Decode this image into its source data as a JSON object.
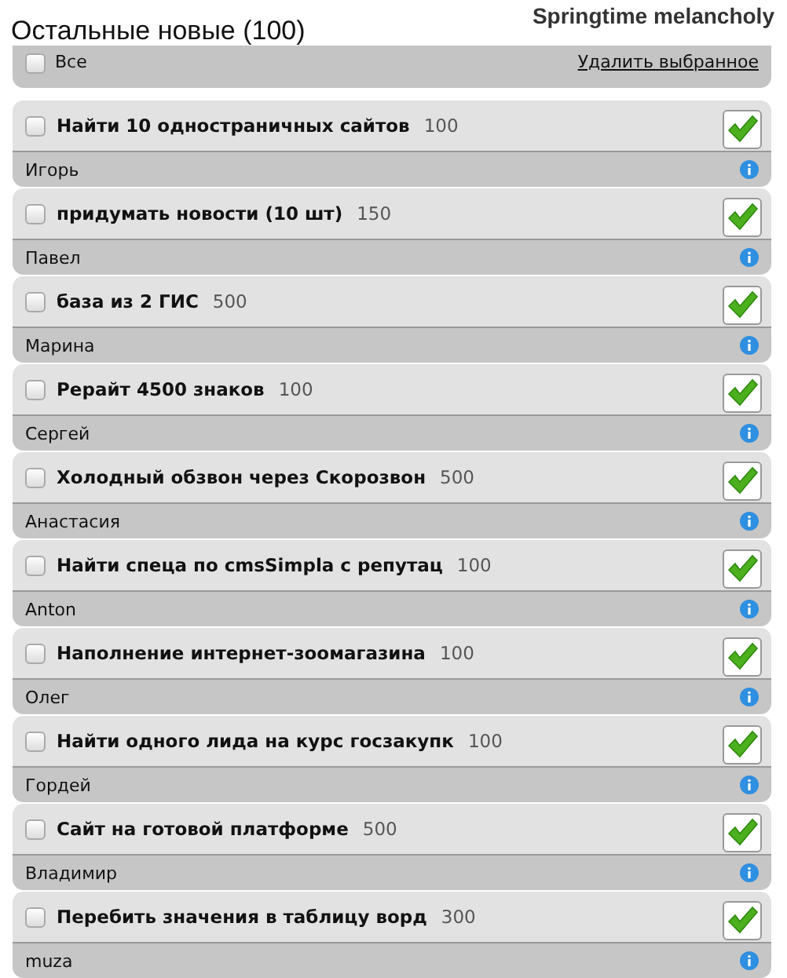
{
  "title": "Остальные новые (100)",
  "user": "Springtime melancholy",
  "select_all": {
    "label": "Все",
    "checked": false
  },
  "delete_link": "Удалить выбранное",
  "tasks": [
    {
      "title": "Найти 10 одностраничных сайтов",
      "price": "100",
      "author": "Игорь",
      "checked": false
    },
    {
      "title": "придумать новости (10 шт)",
      "price": "150",
      "author": "Павел",
      "checked": false
    },
    {
      "title": "база из 2 ГИС",
      "price": "500",
      "author": "Марина",
      "checked": false
    },
    {
      "title": "Рерайт 4500 знаков",
      "price": "100",
      "author": "Сергей",
      "checked": false
    },
    {
      "title": "Холодный обзвон через Скорозвон",
      "price": "500",
      "author": "Анастасия",
      "checked": false
    },
    {
      "title": "Найти спеца по cmsSimpla с репутац",
      "price": "100",
      "author": "Anton",
      "checked": false
    },
    {
      "title": "Наполнение интернет-зоомагазина",
      "price": "100",
      "author": "Олег",
      "checked": false
    },
    {
      "title": "Найти одного лида на курс госзакупк",
      "price": "100",
      "author": "Гордей",
      "checked": false
    },
    {
      "title": "Сайт на готовой платформе",
      "price": "500",
      "author": "Владимир",
      "checked": false
    },
    {
      "title": "Перебить значения в таблицу ворд",
      "price": "300",
      "author": "muza",
      "checked": false
    }
  ]
}
